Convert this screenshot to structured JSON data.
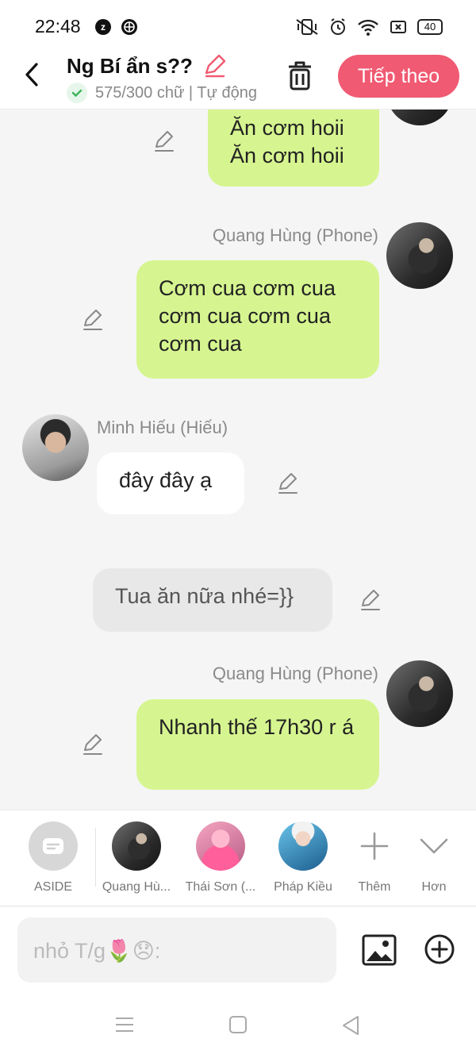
{
  "status_bar": {
    "time": "22:48",
    "app_badge": "z",
    "battery": "40"
  },
  "header": {
    "title": "Ng Bí ẩn s??",
    "subtitle": "575/300 chữ | Tự động",
    "next_button": "Tiếp theo"
  },
  "messages": [
    {
      "sender": "",
      "text": "Ăn cơm hoii\nĂn cơm hoii",
      "style": "green",
      "side": "right"
    },
    {
      "sender": "Quang Hùng (Phone)",
      "text": "Cơm cua cơm cua cơm cua cơm cua cơm cua",
      "style": "green",
      "side": "right"
    },
    {
      "sender": "Minh Hiếu (Hiếu)",
      "text": "đây đây ạ",
      "style": "white",
      "side": "left"
    },
    {
      "sender": "",
      "text": "Tua ăn nữa nhé=}}",
      "style": "gray",
      "side": "center"
    },
    {
      "sender": "Quang Hùng (Phone)",
      "text": "Nhanh thế 17h30 r á",
      "style": "green",
      "side": "right"
    }
  ],
  "character_bar": {
    "items": [
      {
        "label": "ASIDE"
      },
      {
        "label": "Quang Hù..."
      },
      {
        "label": "Thái Sơn (..."
      },
      {
        "label": "Pháp Kiều"
      },
      {
        "label": "Thêm"
      },
      {
        "label": "Hơn"
      }
    ]
  },
  "input": {
    "placeholder": "nhỏ T/g🌷😞:"
  },
  "icons": {
    "back": "chevron-left-icon",
    "edit": "pencil-icon",
    "trash": "trash-icon",
    "image": "image-icon",
    "add": "plus-circle-icon"
  },
  "colors": {
    "accent": "#f05a72",
    "bubble_green": "#d6f590",
    "bubble_gray": "#e8e8e8"
  }
}
